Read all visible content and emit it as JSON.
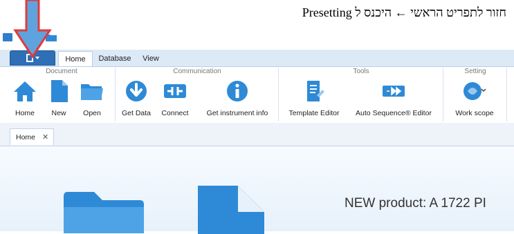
{
  "annotation": {
    "text": "חזור לתפריט הראשי ← היכנס ל Presetting"
  },
  "ribbon": {
    "tabs": [
      {
        "label": "Home",
        "active": true
      },
      {
        "label": "Database",
        "active": false
      },
      {
        "label": "View",
        "active": false
      }
    ],
    "groups": [
      {
        "label": "Document"
      },
      {
        "label": "Communication"
      },
      {
        "label": "Tools"
      },
      {
        "label": "Setting"
      }
    ],
    "buttons": {
      "home": "Home",
      "new": "New",
      "open": "Open",
      "get_data": "Get Data",
      "connect": "Connect",
      "get_instrument_info": "Get instrument info",
      "template_editor": "Template Editor",
      "auto_sequence_editor": "Auto Sequence® Editor",
      "work_scope": "Work scope"
    }
  },
  "document_tabs": [
    {
      "label": "Home",
      "close": "✕"
    }
  ],
  "content": {
    "headline": "NEW product: A 1722 PI"
  },
  "colors": {
    "accent_blue": "#2e8ad6",
    "ribbon_tab_bg": "#dce9f7",
    "annotation_arrow": "#e03a3a"
  }
}
